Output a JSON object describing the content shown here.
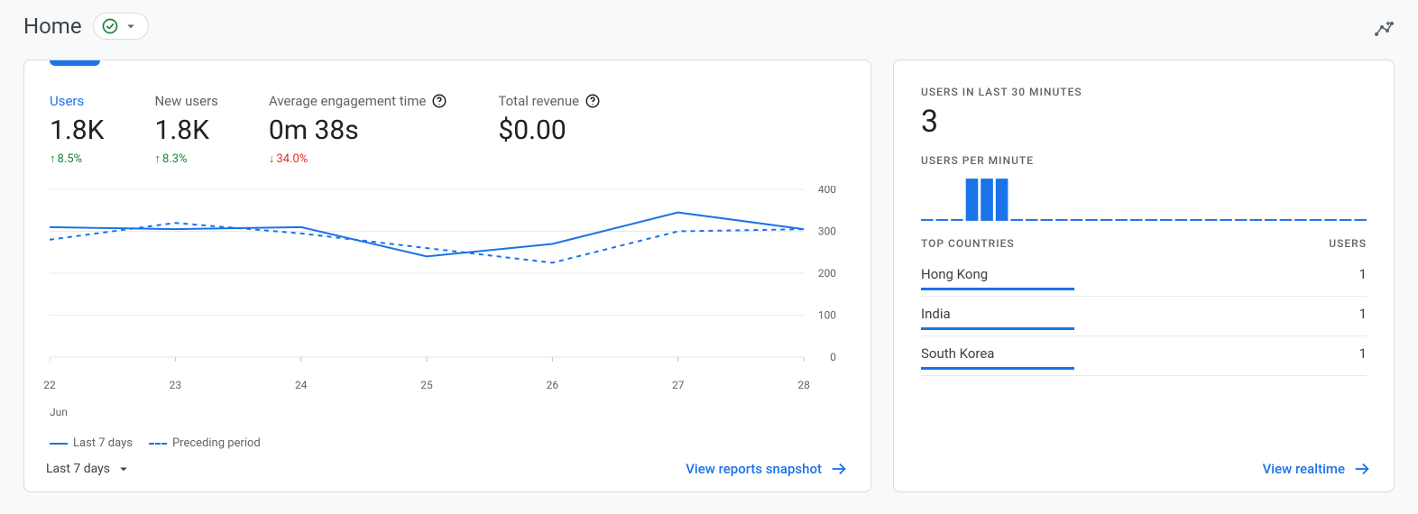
{
  "header": {
    "title": "Home"
  },
  "metrics": [
    {
      "label": "Users",
      "value": "1.8K",
      "delta": "8.5%",
      "dir": "up",
      "help": false,
      "active": true
    },
    {
      "label": "New users",
      "value": "1.8K",
      "delta": "8.3%",
      "dir": "up",
      "help": false,
      "active": false
    },
    {
      "label": "Average engagement time",
      "value": "0m 38s",
      "delta": "34.0%",
      "dir": "down",
      "help": true,
      "active": false
    },
    {
      "label": "Total revenue",
      "value": "$0.00",
      "delta": "",
      "dir": "",
      "help": true,
      "active": false
    }
  ],
  "chart_data": {
    "type": "line",
    "categories": [
      "22",
      "23",
      "24",
      "25",
      "26",
      "27",
      "28"
    ],
    "month": "Jun",
    "ylim": [
      0,
      400
    ],
    "yticks": [
      0,
      100,
      200,
      300,
      400
    ],
    "series": [
      {
        "name": "Last 7 days",
        "style": "solid",
        "values": [
          310,
          305,
          310,
          240,
          270,
          345,
          305
        ]
      },
      {
        "name": "Preceding period",
        "style": "dashed",
        "values": [
          280,
          320,
          295,
          260,
          225,
          300,
          305
        ]
      }
    ]
  },
  "range_picker": "Last 7 days",
  "left_link": "View reports snapshot",
  "realtime": {
    "label": "USERS IN LAST 30 MINUTES",
    "value": "3",
    "upm_label": "USERS PER MINUTE",
    "minutes": [
      0,
      0,
      0,
      1,
      1,
      1,
      0,
      0,
      0,
      0,
      0,
      0,
      0,
      0,
      0,
      0,
      0,
      0,
      0,
      0,
      0,
      0,
      0,
      0,
      0,
      0,
      0,
      0,
      0,
      0
    ],
    "countries_head": {
      "left": "TOP COUNTRIES",
      "right": "USERS"
    },
    "countries": [
      {
        "name": "Hong Kong",
        "users": "1",
        "bar": 1
      },
      {
        "name": "India",
        "users": "1",
        "bar": 1
      },
      {
        "name": "South Korea",
        "users": "1",
        "bar": 1
      }
    ],
    "link": "View realtime"
  }
}
